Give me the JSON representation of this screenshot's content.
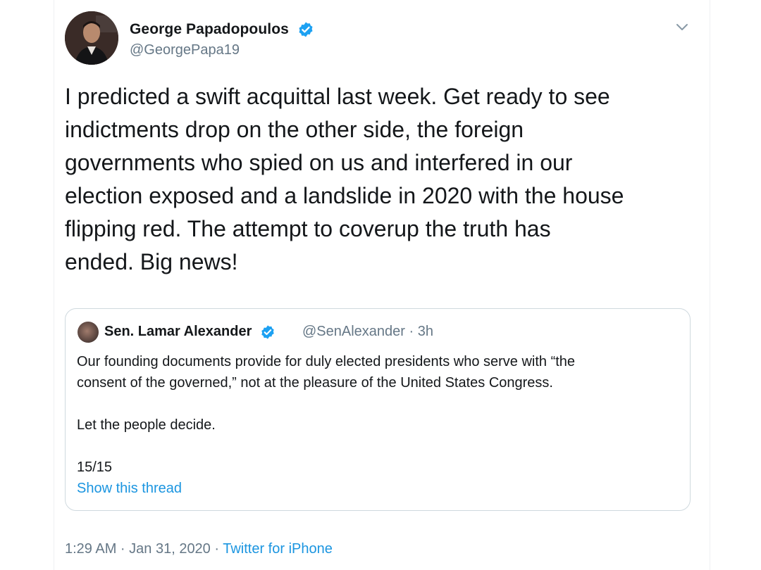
{
  "author": {
    "display_name": "George Papadopoulos",
    "handle": "@GeorgePapa19",
    "verified": true
  },
  "tweet": {
    "text": "I predicted a swift acquittal last week. Get ready to see\nindictments drop on the other side, the foreign\ngovernments who spied on us and interfered in our\nelection exposed and a landslide in 2020 with the house\nflipping red. The attempt to coverup the truth has\nended. Big news!"
  },
  "quoted_tweet": {
    "display_name": "Sen. Lamar Alexander",
    "handle_time": "@SenAlexander · 3h",
    "text": "Our founding documents provide for duly elected presidents who serve with “the\nconsent of the governed,” not at the pleasure of the United States Congress.\n\nLet the people decide.\n\n15/15",
    "show_thread": "Show this thread"
  },
  "meta": {
    "timestamp": "1:29 AM · Jan 31, 2020 · ",
    "source": "Twitter for iPhone"
  },
  "icons": {
    "verified": "verified-badge-icon",
    "more": "chevron-down-icon"
  },
  "colors": {
    "text_primary": "#14171a",
    "text_secondary": "#657786",
    "link": "#1b95e0",
    "verified": "#1da1f2",
    "border": "#cfd9de"
  }
}
